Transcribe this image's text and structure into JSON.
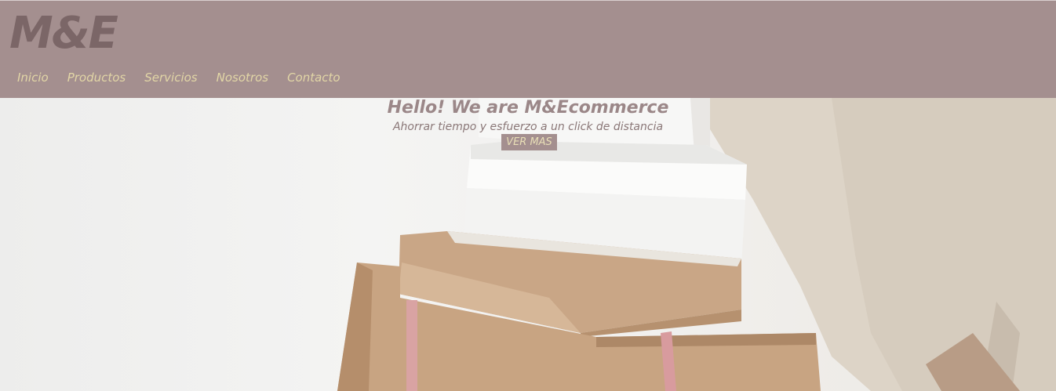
{
  "header": {
    "logo": "M&E",
    "nav": [
      "Inicio",
      "Productos",
      "Servicios",
      "Nosotros",
      "Contacto"
    ]
  },
  "hero": {
    "title": "Hello! We are M&Ecommerce",
    "subtitle": "Ahorrar tiempo y esfuerzo a un click de distancia",
    "cta_label": "VER MAS"
  },
  "colors": {
    "header_bg": "#a48f8f",
    "logo": "#7b6667",
    "nav_text": "#e2d6a6",
    "cta_bg": "#a48f8f",
    "cta_text": "#e9dfb7"
  }
}
